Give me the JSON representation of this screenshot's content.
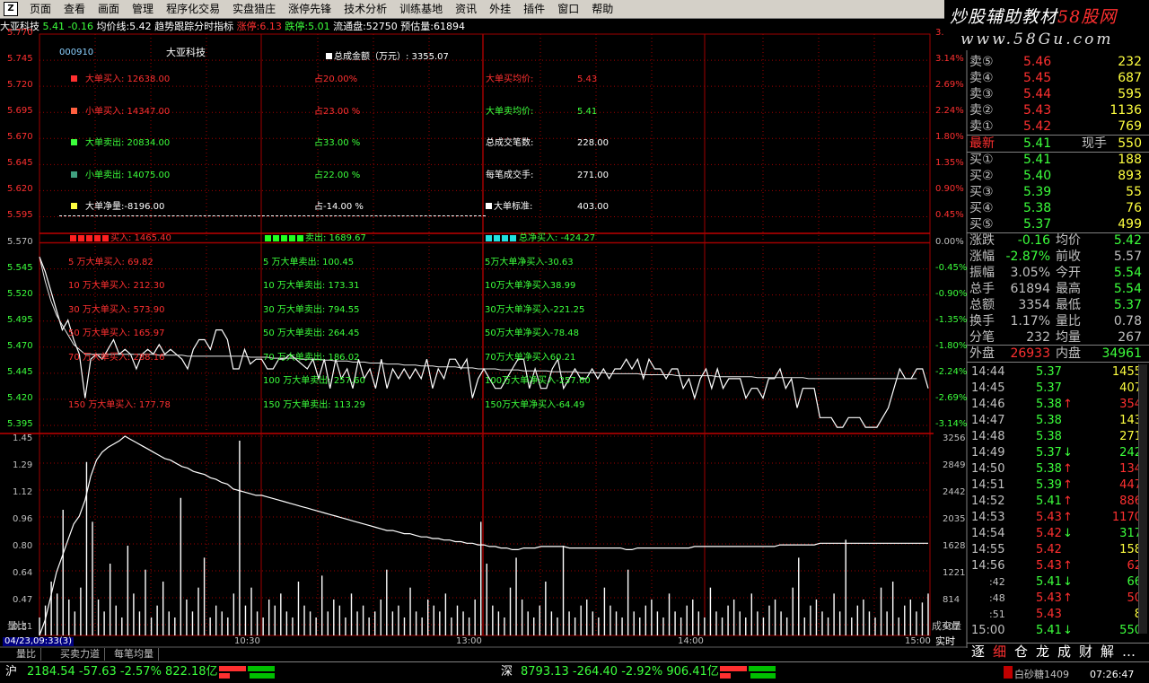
{
  "menu": {
    "items": [
      "页面",
      "查看",
      "画面",
      "管理",
      "程序化交易",
      "实盘猎庄",
      "涨停先锋",
      "技术分析",
      "训练基地",
      "资讯",
      "外挂",
      "插件",
      "窗口",
      "帮助"
    ]
  },
  "brand": {
    "line1a": "炒股辅助教材",
    "line1b": "58股网",
    "line2": "www.58Gu.com"
  },
  "info": {
    "name": "大亚科技",
    "price": "5.41",
    "change": "-0.16",
    "avg_label": "均价线:5.42",
    "indicator": "趋势跟踪分时指标",
    "limit_up": "涨停:6.13",
    "limit_down": "跌停:5.01",
    "float": "流通盘:52750",
    "estimate": "预估量:61894"
  },
  "price_axis": {
    "left": [
      "5.770",
      "5.745",
      "5.720",
      "5.695",
      "5.670",
      "5.645",
      "5.620",
      "5.595",
      "5.570",
      "5.545",
      "5.520",
      "5.495",
      "5.470",
      "5.445",
      "5.420",
      "5.395"
    ],
    "right": [
      "3.",
      "3.14%",
      "2.69%",
      "2.24%",
      "1.80%",
      "1.35%",
      "0.90%",
      "0.45%",
      "0.00%",
      "-0.45%",
      "-0.90%",
      "-1.35%",
      "-1.80%",
      "-2.24%",
      "-2.69%",
      "-3.14%"
    ]
  },
  "vol_axis": {
    "left": [
      "1.45",
      "1.29",
      "1.12",
      "0.96",
      "0.80",
      "0.64",
      "0.47",
      "0.31"
    ],
    "right": [
      "3256",
      "2849",
      "2442",
      "2035",
      "1628",
      "1221",
      "814",
      "407"
    ],
    "bottom_left": "量比",
    "bottom_right": "成交量"
  },
  "time_axis": {
    "date": "04/23,09:33(3)",
    "ticks": [
      "10:30",
      "13:00",
      "14:00",
      "15:00"
    ],
    "right": "实时"
  },
  "overlay": {
    "code": "000910",
    "name": "大亚科技",
    "total_amount": "总成金额（万元）: 3355.07",
    "rows": [
      {
        "label": "大单买入: 12638.00",
        "pct": "占20.00%",
        "color": "#ff3030"
      },
      {
        "label": "小单买入: 14347.00",
        "pct": "占23.00 %",
        "color": "#ff3030"
      },
      {
        "label": "大单卖出: 20834.00",
        "pct": "占33.00 %",
        "color": "#3cff3c"
      },
      {
        "label": "小单卖出: 14075.00",
        "pct": "占22.00 %",
        "color": "#3cff3c"
      },
      {
        "label": "大单净量:-8196.00",
        "pct": "占-14.00 %",
        "color": "#ffffff"
      }
    ],
    "right_rows": [
      {
        "label": "大单买均价:",
        "value": "5.43",
        "color": "#ff3030"
      },
      {
        "label": "大单卖均价:",
        "value": "5.41",
        "color": "#3cff3c"
      },
      {
        "label": "总成交笔数:",
        "value": "228.00",
        "color": "#ffffff"
      },
      {
        "label": "每笔成交手:",
        "value": "271.00",
        "color": "#ffffff"
      },
      {
        "label": "大单标准:",
        "value": "403.00",
        "color": "#ffffff"
      }
    ],
    "buy_head": "买入: 1465.40",
    "sell_head": "卖出: 1689.67",
    "net_head": "总净买入: -424.27",
    "buy": [
      "5 万大单买入: 69.82",
      "10 万大单买入: 212.30",
      "30 万大单买入: 573.90",
      "50 万大单买入: 165.97",
      "70 万大单买入: 288.16",
      "150 万大单买入: 177.78"
    ],
    "sell": [
      "5 万大单卖出: 100.45",
      "10 万大单卖出: 173.31",
      "30 万大单卖出: 794.55",
      "50 万大单卖出: 264.45",
      "70 万大单卖出: 186.02",
      "100 万大单卖出: 257.60",
      "150 万大单卖出: 113.29"
    ],
    "net": [
      "5万大单净买入-30.63",
      "10万大单净买入38.99",
      "30万大单净买入-221.25",
      "50万大单净买入-78.48",
      "70万大单净买入60.21",
      "100万大单净买入-257.60",
      "150万大单净买入-64.49"
    ]
  },
  "bottom_tabs": [
    "量比",
    "买卖力道",
    "每笔均量"
  ],
  "quote": {
    "asks": [
      {
        "l": "卖⑤",
        "p": "5.46",
        "v": "232"
      },
      {
        "l": "卖④",
        "p": "5.45",
        "v": "687"
      },
      {
        "l": "卖③",
        "p": "5.44",
        "v": "595"
      },
      {
        "l": "卖②",
        "p": "5.43",
        "v": "1136"
      },
      {
        "l": "卖①",
        "p": "5.42",
        "v": "769"
      }
    ],
    "last": {
      "l": "最新",
      "p": "5.41",
      "l2": "现手",
      "v": "550"
    },
    "bids": [
      {
        "l": "买①",
        "p": "5.41",
        "v": "188"
      },
      {
        "l": "买②",
        "p": "5.40",
        "v": "893"
      },
      {
        "l": "买③",
        "p": "5.39",
        "v": "55"
      },
      {
        "l": "买④",
        "p": "5.38",
        "v": "76"
      },
      {
        "l": "买⑤",
        "p": "5.37",
        "v": "499"
      }
    ],
    "stats": [
      {
        "a": "涨跌",
        "b": "-0.16",
        "c": "均价",
        "d": "5.42"
      },
      {
        "a": "涨幅",
        "b": "-2.87%",
        "c": "前收",
        "d": "5.57"
      },
      {
        "a": "振幅",
        "b": "3.05%",
        "c": "今开",
        "d": "5.54"
      },
      {
        "a": "总手",
        "b": "61894",
        "c": "最高",
        "d": "5.54"
      },
      {
        "a": "总额",
        "b": "3354",
        "c": "最低",
        "d": "5.37"
      },
      {
        "a": "换手",
        "b": "1.17%",
        "c": "量比",
        "d": "0.78"
      },
      {
        "a": "分笔",
        "b": "232",
        "c": "均量",
        "d": "267"
      }
    ],
    "outer": {
      "a": "外盘",
      "b": "26933",
      "c": "内盘",
      "d": "34961"
    },
    "ticks": [
      {
        "t": "14:44",
        "p": "5.37",
        "a": "",
        "v": "1455"
      },
      {
        "t": "14:45",
        "p": "5.37",
        "a": "",
        "v": "407"
      },
      {
        "t": "14:46",
        "p": "5.38",
        "a": "↑",
        "v": "354"
      },
      {
        "t": "14:47",
        "p": "5.38",
        "a": "",
        "v": "143"
      },
      {
        "t": "14:48",
        "p": "5.38",
        "a": "",
        "v": "271"
      },
      {
        "t": "14:49",
        "p": "5.37",
        "a": "↓",
        "v": "242"
      },
      {
        "t": "14:50",
        "p": "5.38",
        "a": "↑",
        "v": "134"
      },
      {
        "t": "14:51",
        "p": "5.39",
        "a": "↑",
        "v": "447"
      },
      {
        "t": "14:52",
        "p": "5.41",
        "a": "↑",
        "v": "886"
      },
      {
        "t": "14:53",
        "p": "5.43",
        "a": "↑",
        "v": "1170"
      },
      {
        "t": "14:54",
        "p": "5.42",
        "a": "↓",
        "v": "317"
      },
      {
        "t": "14:55",
        "p": "5.42",
        "a": "",
        "v": "158"
      },
      {
        "t": "14:56",
        "p": "5.43",
        "a": "↑",
        "v": "62"
      },
      {
        "t": ":42",
        "p": "5.41",
        "a": "↓",
        "v": "66"
      },
      {
        "t": ":48",
        "p": "5.43",
        "a": "↑",
        "v": "50"
      },
      {
        "t": ":51",
        "p": "5.43",
        "a": "",
        "v": "8"
      },
      {
        "t": "15:00",
        "p": "5.41",
        "a": "↓",
        "v": "550"
      }
    ],
    "bottom_tabs": [
      "逐",
      "细",
      "仓",
      "龙",
      "成",
      "财",
      "解",
      "…"
    ]
  },
  "status": {
    "sh_label": "沪",
    "sh": "2184.54 -57.63 -2.57% 822.18亿",
    "sz_label": "深",
    "sz": "8793.13 -264.40 -2.92% 906.41亿",
    "ticker": "白砂糖1409",
    "clock": "07:26:47"
  },
  "series": {
    "price": [
      5.545,
      5.53,
      5.51,
      5.49,
      5.47,
      5.48,
      5.46,
      5.445,
      5.4,
      5.44,
      5.445,
      5.44,
      5.45,
      5.46,
      5.445,
      5.45,
      5.445,
      5.43,
      5.445,
      5.45,
      5.445,
      5.455,
      5.445,
      5.45,
      5.445,
      5.44,
      5.43,
      5.45,
      5.46,
      5.46,
      5.45,
      5.47,
      5.47,
      5.46,
      5.43,
      5.43,
      5.45,
      5.435,
      5.44,
      5.44,
      5.43,
      5.43,
      5.44,
      5.44,
      5.445,
      5.44,
      5.435,
      5.43,
      5.44,
      5.42,
      5.44,
      5.41,
      5.44,
      5.42,
      5.43,
      5.41,
      5.44,
      5.42,
      5.43,
      5.41,
      5.44,
      5.41,
      5.43,
      5.42,
      5.43,
      5.42,
      5.43,
      5.42,
      5.44,
      5.41,
      5.43,
      5.42,
      5.44,
      5.44,
      5.43,
      5.44,
      5.4,
      5.42,
      5.43,
      5.42,
      5.41,
      5.41,
      5.42,
      5.43,
      5.44,
      5.44,
      5.41,
      5.43,
      5.41,
      5.41,
      5.43,
      5.44,
      5.41,
      5.42,
      5.43,
      5.42,
      5.42,
      5.43,
      5.42,
      5.43,
      5.42,
      5.43,
      5.43,
      5.44,
      5.43,
      5.44,
      5.42,
      5.44,
      5.43,
      5.43,
      5.42,
      5.43,
      5.43,
      5.41,
      5.42,
      5.4,
      5.42,
      5.43,
      5.41,
      5.43,
      5.41,
      5.42,
      5.42,
      5.42,
      5.4,
      5.41,
      5.41,
      5.4,
      5.42,
      5.42,
      5.43,
      5.41,
      5.42,
      5.39,
      5.41,
      5.41,
      5.41,
      5.38,
      5.38,
      5.38,
      5.37,
      5.37,
      5.38,
      5.38,
      5.38,
      5.37,
      5.37,
      5.37,
      5.38,
      5.39,
      5.41,
      5.43,
      5.42,
      5.42,
      5.43,
      5.43,
      5.41
    ],
    "avg": [
      5.545,
      5.52,
      5.5,
      5.485,
      5.475,
      5.465,
      5.455,
      5.45,
      5.445,
      5.445,
      5.445,
      5.445,
      5.445,
      5.445,
      5.445,
      5.445,
      5.445,
      5.445,
      5.445,
      5.445,
      5.445,
      5.444,
      5.444,
      5.444,
      5.444,
      5.444,
      5.443,
      5.443,
      5.443,
      5.443,
      5.443,
      5.443,
      5.443,
      5.443,
      5.443,
      5.443,
      5.443,
      5.442,
      5.442,
      5.442,
      5.442,
      5.441,
      5.441,
      5.441,
      5.441,
      5.441,
      5.44,
      5.44,
      5.44,
      5.44,
      5.439,
      5.439,
      5.438,
      5.438,
      5.438,
      5.437,
      5.437,
      5.437,
      5.436,
      5.436,
      5.436,
      5.435,
      5.435,
      5.435,
      5.434,
      5.434,
      5.434,
      5.433,
      5.433,
      5.433,
      5.432,
      5.432,
      5.432,
      5.432,
      5.431,
      5.431,
      5.431,
      5.43,
      5.43,
      5.43,
      5.43,
      5.429,
      5.429,
      5.429,
      5.429,
      5.428,
      5.428,
      5.428,
      5.428,
      5.428,
      5.427,
      5.427,
      5.427,
      5.427,
      5.427,
      5.426,
      5.426,
      5.426,
      5.426,
      5.426,
      5.425,
      5.425,
      5.425,
      5.425,
      5.425,
      5.425,
      5.424,
      5.424,
      5.424,
      5.424,
      5.424,
      5.424,
      5.423,
      5.423,
      5.423,
      5.423,
      5.423,
      5.423,
      5.423,
      5.422,
      5.422,
      5.422,
      5.422,
      5.422,
      5.422,
      5.422,
      5.421,
      5.421,
      5.421,
      5.421,
      5.421,
      5.421,
      5.421,
      5.421,
      5.421,
      5.42,
      5.42,
      5.42,
      5.42,
      5.42,
      5.42,
      5.42,
      5.42,
      5.42,
      5.42,
      5.42,
      5.42,
      5.42,
      5.42,
      5.42,
      5.42,
      5.42,
      5.42,
      5.42,
      5.42
    ],
    "ratio": [
      0.2,
      0.3,
      0.45,
      0.6,
      0.7,
      0.8,
      0.9,
      0.95,
      1.05,
      1.2,
      1.3,
      1.35,
      1.38,
      1.4,
      1.42,
      1.45,
      1.43,
      1.41,
      1.39,
      1.37,
      1.35,
      1.33,
      1.31,
      1.3,
      1.28,
      1.26,
      1.25,
      1.23,
      1.22,
      1.21,
      1.19,
      1.18,
      1.16,
      1.15,
      1.12,
      1.11,
      1.1,
      1.09,
      1.08,
      1.08,
      1.07,
      1.06,
      1.05,
      1.04,
      1.03,
      1.02,
      1.01,
      1.0,
      0.99,
      0.98,
      0.97,
      0.96,
      0.95,
      0.94,
      0.93,
      0.92,
      0.91,
      0.9,
      0.89,
      0.88,
      0.87,
      0.86,
      0.86,
      0.85,
      0.84,
      0.84,
      0.83,
      0.82,
      0.82,
      0.81,
      0.81,
      0.8,
      0.8,
      0.79,
      0.79,
      0.78,
      0.78,
      0.77,
      0.77,
      0.76,
      0.76,
      0.75,
      0.75,
      0.74,
      0.74,
      0.75,
      0.75,
      0.75,
      0.76,
      0.76,
      0.76,
      0.76,
      0.76,
      0.75,
      0.75,
      0.75,
      0.75,
      0.75,
      0.75,
      0.75,
      0.75,
      0.75,
      0.75,
      0.74,
      0.74,
      0.75,
      0.75,
      0.75,
      0.75,
      0.75,
      0.75,
      0.75,
      0.75,
      0.75,
      0.75,
      0.76,
      0.76,
      0.76,
      0.76,
      0.76,
      0.76,
      0.76,
      0.76,
      0.76,
      0.76,
      0.76,
      0.76,
      0.76,
      0.76,
      0.76,
      0.77,
      0.77,
      0.77,
      0.77,
      0.77,
      0.77,
      0.77,
      0.78,
      0.78,
      0.78,
      0.78,
      0.78,
      0.78,
      0.78,
      0.78,
      0.78,
      0.78,
      0.78,
      0.78,
      0.78,
      0.78,
      0.78,
      0.78,
      0.78,
      0.78,
      0.78,
      0.78
    ],
    "vol": [
      300,
      500,
      900,
      700,
      2100,
      600,
      400,
      800,
      2900,
      1900,
      600,
      400,
      1200,
      500,
      300,
      1500,
      700,
      400,
      1100,
      300,
      500,
      900,
      400,
      300,
      2300,
      600,
      400,
      800,
      1300,
      300,
      500,
      400,
      300,
      700,
      3256,
      500,
      800,
      400,
      300,
      600,
      500,
      700,
      400,
      300,
      900,
      500,
      400,
      300,
      1000,
      400,
      600,
      500,
      300,
      700,
      400,
      500,
      300,
      400,
      600,
      1100,
      400,
      500,
      300,
      800,
      400,
      300,
      600,
      500,
      400,
      700,
      300,
      500,
      400,
      300,
      600,
      1900,
      1200,
      500,
      400,
      300,
      800,
      1300,
      600,
      400,
      300,
      500,
      900,
      400,
      300,
      1500,
      400,
      300,
      500,
      600,
      400,
      300,
      800,
      500,
      400,
      300,
      1100,
      400,
      300,
      500,
      600,
      400,
      300,
      700,
      400,
      300,
      500,
      600,
      400,
      300,
      800,
      400,
      300,
      500,
      600,
      400,
      300,
      700,
      400,
      300,
      500,
      600,
      400,
      300,
      800,
      1300,
      300,
      500,
      600,
      400,
      300,
      700,
      400,
      1600,
      300,
      500,
      600,
      400,
      300,
      800,
      400,
      900,
      300,
      500,
      600,
      400,
      550,
      700
    ]
  }
}
